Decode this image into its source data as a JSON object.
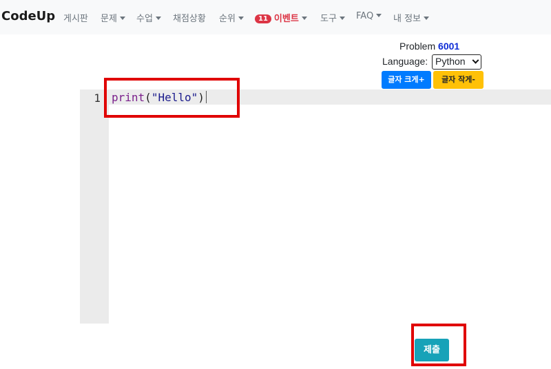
{
  "navbar": {
    "brand": "CodeUp",
    "items": [
      {
        "label": "게시판",
        "dropdown": false
      },
      {
        "label": "문제",
        "dropdown": true
      },
      {
        "label": "수업",
        "dropdown": true
      },
      {
        "label": "채점상황",
        "dropdown": false
      },
      {
        "label": "순위",
        "dropdown": true
      },
      {
        "label": "이벤트",
        "dropdown": true,
        "badge": "11"
      },
      {
        "label": "도구",
        "dropdown": true
      },
      {
        "label": "FAQ",
        "dropdown": true
      },
      {
        "label": "내 정보",
        "dropdown": true
      }
    ]
  },
  "problem": {
    "label": "Problem",
    "number": "6001",
    "language_label": "Language:",
    "language_selected": "Python"
  },
  "font_buttons": {
    "increase": "글자 크게+",
    "decrease": "글자 작게-"
  },
  "editor": {
    "line_number": "1",
    "code_keyword": "print",
    "code_open": "(",
    "code_string": "\"Hello\"",
    "code_close": ")"
  },
  "submit_label": "제출",
  "colors": {
    "primary": "#007bff",
    "warning": "#ffc107",
    "info": "#17a2b8",
    "danger": "#dc3545",
    "highlight": "#e00000"
  }
}
